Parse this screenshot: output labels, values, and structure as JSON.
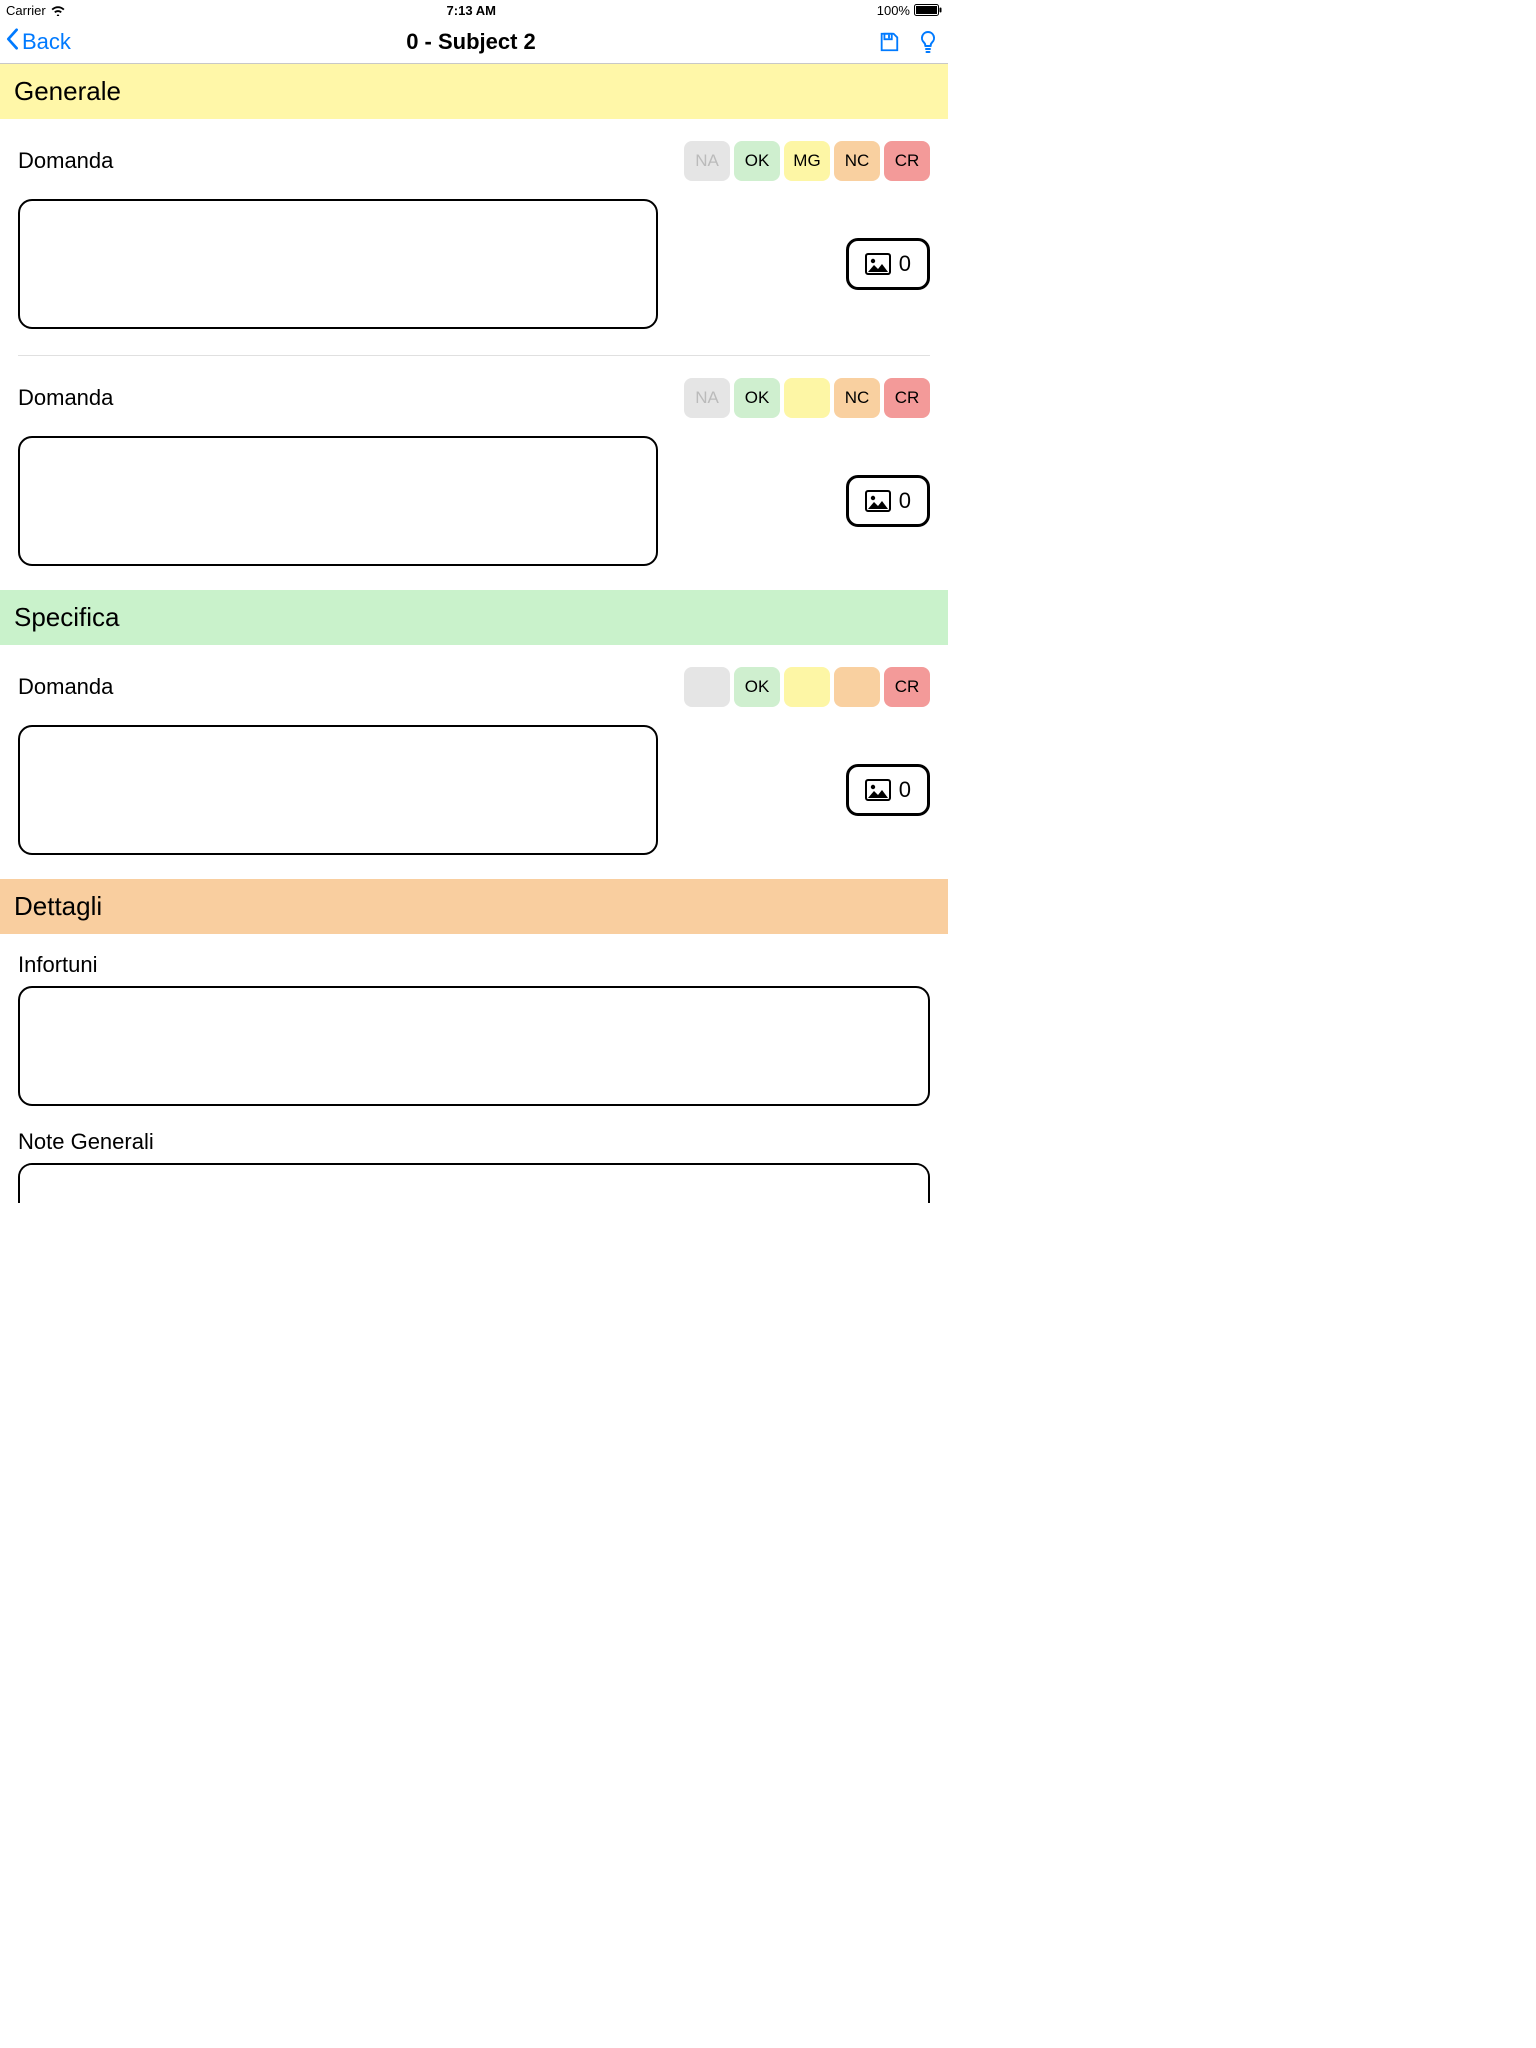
{
  "status": {
    "carrier": "Carrier",
    "time": "7:13 AM",
    "battery": "100%"
  },
  "nav": {
    "back_label": "Back",
    "title": "0 - Subject 2"
  },
  "pill_labels": {
    "na": "NA",
    "ok": "OK",
    "mg": "MG",
    "nc": "NC",
    "cr": "CR"
  },
  "sections": {
    "generale": {
      "title": "Generale"
    },
    "specifica": {
      "title": "Specifica"
    },
    "dettagli": {
      "title": "Dettagli"
    }
  },
  "q_label": "Domanda",
  "q1": {
    "photo_count": "0"
  },
  "q2": {
    "photo_count": "0"
  },
  "q3": {
    "photo_count": "0"
  },
  "dettagli": {
    "infortuni_label": "Infortuni",
    "note_label": "Note Generali"
  }
}
